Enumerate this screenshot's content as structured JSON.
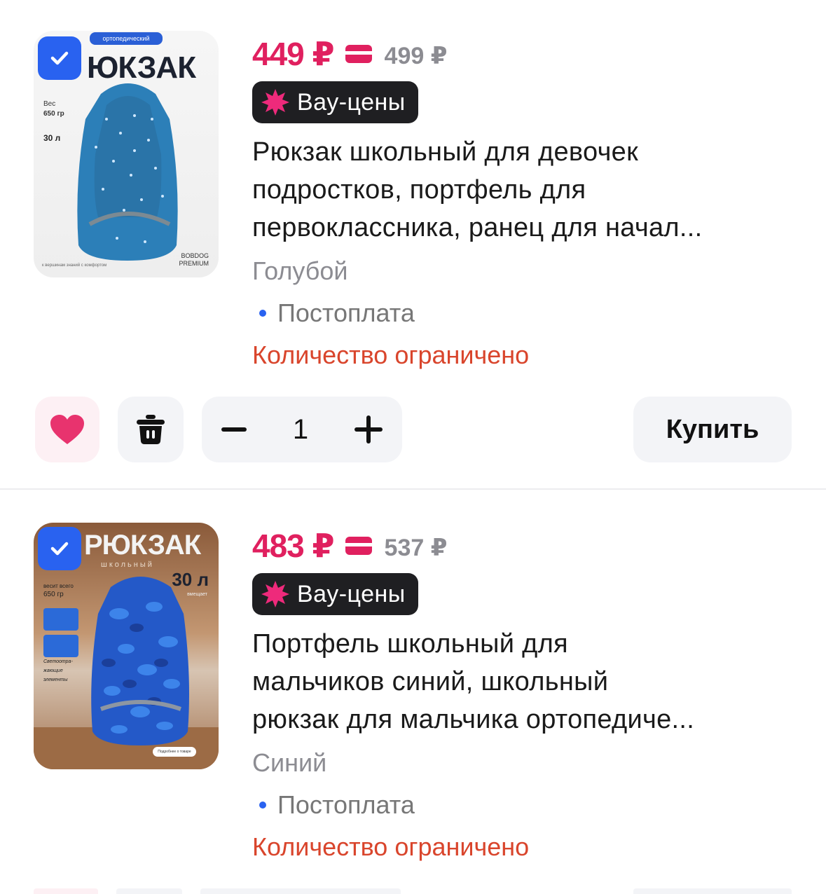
{
  "items": [
    {
      "image": {
        "tag": "ортопедический",
        "title": "ЮКЗАК",
        "side_weight_label": "Вес",
        "side_weight": "650 гр",
        "volume": "30 л",
        "brand_line1": "BOBDOG",
        "brand_line2": "PREMIUM",
        "footer": "к вершинам знаний с комфортом",
        "bag_color": "#2c7fb8"
      },
      "selected": true,
      "price": "449 ₽",
      "old_price": "499 ₽",
      "badge": "Вау-цены",
      "title_lines": [
        "Рюкзак школьный для девочек",
        "подростков, портфель для",
        "первоклассника, ранец для начал..."
      ],
      "color": "Голубой",
      "payment": "Постоплата",
      "stock_note": "Количество ограничено",
      "quantity": "1",
      "buy_label": "Купить"
    },
    {
      "image": {
        "title": "РЮКЗАК",
        "subtitle": "школьный",
        "volume": "30 л",
        "volume_note": "вмещает",
        "side_weight_label": "весит всего",
        "side_weight": "650 гр",
        "side_note1": "Светоотра-",
        "side_note2": "жающие",
        "side_note3": "элементы",
        "pill": "Подробнее о товаре",
        "bag_color": "#2459c8"
      },
      "selected": true,
      "price": "483 ₽",
      "old_price": "537 ₽",
      "badge": "Вау-цены",
      "title_lines": [
        "Портфель школьный для",
        "мальчиков синий, школьный",
        "рюкзак для мальчика ортопедиче..."
      ],
      "color": "Синий",
      "payment": "Постоплата",
      "stock_note": "Количество ограничено"
    }
  ],
  "colors": {
    "price": "#e0205f",
    "checkbox": "#2962f0",
    "stock_note": "#d9452c",
    "heart": "#e8336e",
    "badge_bg": "#1f1f22",
    "badge_star": "#ee2a7b"
  }
}
